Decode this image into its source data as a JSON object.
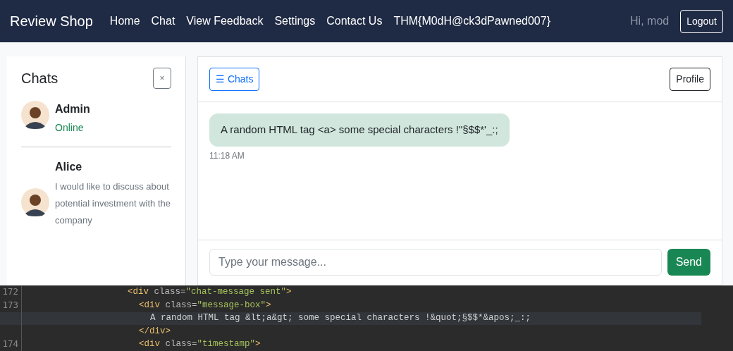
{
  "navbar": {
    "brand": "Review Shop",
    "links": [
      "Home",
      "Chat",
      "View Feedback",
      "Settings",
      "Contact Us",
      "THM{M0dH@ck3dPawned007}"
    ],
    "greeting": "Hi, mod",
    "logout": "Logout"
  },
  "sidebar": {
    "title": "Chats",
    "close": "×",
    "contacts": [
      {
        "name": "Admin",
        "kind": "status",
        "subtitle": "Online"
      },
      {
        "name": "Alice",
        "kind": "preview",
        "subtitle": "I would like to discuss about potential investment with the company"
      }
    ]
  },
  "chat": {
    "toggle": "☰ Chats",
    "profile": "Profile",
    "messages": [
      {
        "text": "A random HTML tag <a> some special characters !\"§$$*'_:;",
        "time": "11:18 AM"
      }
    ],
    "input": {
      "placeholder": "Type your message..."
    },
    "send": "Send"
  },
  "editor": {
    "lines": [
      {
        "number": "172",
        "current": false,
        "segments": [
          {
            "kind": "tag",
            "text": "<div "
          },
          {
            "kind": "attr",
            "text": "class="
          },
          {
            "kind": "value",
            "text": "\"chat-message sent\""
          },
          {
            "kind": "tag",
            "text": ">"
          }
        ],
        "children": [
          {
            "number": "173",
            "current": false,
            "segments": [
              {
                "kind": "tag",
                "text": "<div "
              },
              {
                "kind": "attr",
                "text": "class="
              },
              {
                "kind": "value",
                "text": "\"message-box\""
              },
              {
                "kind": "tag",
                "text": ">"
              }
            ],
            "children": [
              {
                "current": true,
                "segments": [
                  {
                    "kind": "text",
                    "text": "A random HTML tag &lt;a&gt; some special characters !&quot;§$$*&apos;_:;"
                  }
                ]
              }
            ]
          },
          {
            "current": false,
            "segments": [
              {
                "kind": "tag",
                "text": "</div>"
              }
            ]
          },
          {
            "number": "174",
            "current": false,
            "segments": [
              {
                "kind": "tag",
                "text": "<div "
              },
              {
                "kind": "attr",
                "text": "class="
              },
              {
                "kind": "value",
                "text": "\"timestamp\""
              },
              {
                "kind": "tag",
                "text": ">"
              }
            ]
          }
        ]
      }
    ]
  }
}
